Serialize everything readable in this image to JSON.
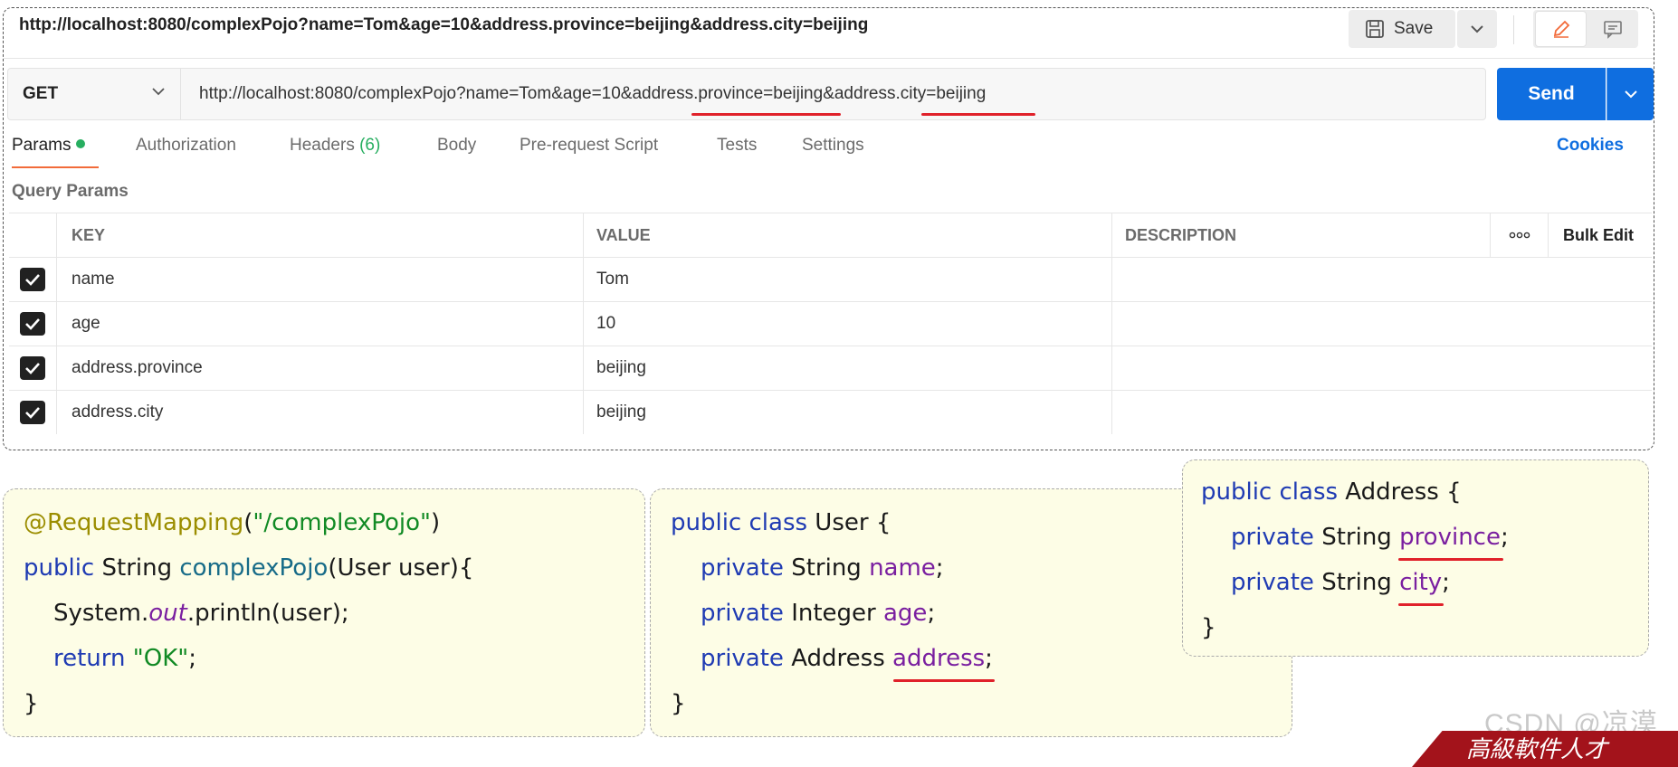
{
  "header": {
    "url_text": "http://localhost:8080/complexPojo?name=Tom&age=10&address.province=beijing&address.city=beijing",
    "save_label": "Save"
  },
  "request": {
    "method": "GET",
    "url": "http://localhost:8080/complexPojo?name=Tom&age=10&address.province=beijing&address.city=beijing",
    "send_label": "Send"
  },
  "tabs": {
    "params": "Params",
    "authorization": "Authorization",
    "headers": "Headers",
    "headers_count": "(6)",
    "body": "Body",
    "prerequest": "Pre-request Script",
    "tests": "Tests",
    "settings": "Settings",
    "cookies": "Cookies"
  },
  "query_params": {
    "title": "Query Params",
    "columns": {
      "key": "KEY",
      "value": "VALUE",
      "description": "DESCRIPTION",
      "bulk_edit": "Bulk Edit"
    },
    "rows": [
      {
        "key": "name",
        "value": "Tom",
        "checked": true
      },
      {
        "key": "age",
        "value": "10",
        "checked": true
      },
      {
        "key": "address.province",
        "value": "beijing",
        "checked": true
      },
      {
        "key": "address.city",
        "value": "beijing",
        "checked": true
      }
    ]
  },
  "code": {
    "controller": {
      "annotation": "@RequestMapping",
      "annotation_arg": "\"/complexPojo\"",
      "public_kw": "public",
      "return_type": " String ",
      "method_name": "complexPojo",
      "params": "(User user){",
      "sys_prefix": "System.",
      "sys_out": "out",
      "sys_suffix": ".println(user);",
      "return_kw": "return",
      "return_val": "\"OK\"",
      "close": "}"
    },
    "user": {
      "decl_kw": "public class",
      "decl_name": " User {",
      "f1_kw": "private",
      "f1_type": " String ",
      "f1_name": "name",
      "f2_kw": "private",
      "f2_type": " Integer ",
      "f2_name": "age",
      "f3_kw": "private",
      "f3_type": " Address ",
      "f3_name": "address",
      "close": "}"
    },
    "address": {
      "decl_kw": "public class",
      "decl_name": " Address {",
      "f1_kw": "private",
      "f1_type": " String ",
      "f1_name": "province",
      "f2_kw": "private",
      "f2_type": " String ",
      "f2_name": "city",
      "close": "}"
    }
  },
  "watermark": "CSDN @凉漠",
  "banner_text": "高級軟件人才"
}
